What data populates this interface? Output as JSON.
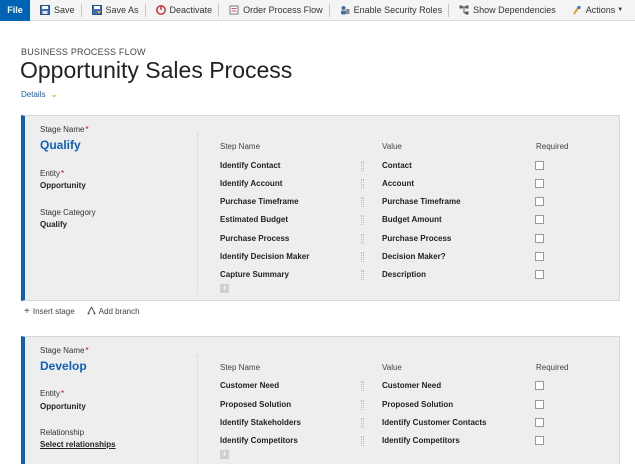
{
  "toolbar": {
    "file": "File",
    "save": "Save",
    "save_as": "Save As",
    "deactivate": "Deactivate",
    "order_process_flow": "Order Process Flow",
    "enable_security_roles": "Enable Security Roles",
    "show_dependencies": "Show Dependencies",
    "actions": "Actions"
  },
  "header": {
    "label": "BUSINESS PROCESS FLOW",
    "title": "Opportunity Sales Process",
    "details": "Details"
  },
  "columns": {
    "step_name": "Step Name",
    "value": "Value",
    "required": "Required"
  },
  "stage_labels": {
    "stage_name": "Stage Name",
    "entity": "Entity",
    "stage_category": "Stage Category",
    "relationship": "Relationship",
    "required_marker": "*"
  },
  "stages": [
    {
      "name": "Qualify",
      "entity": "Opportunity",
      "category": "Qualify",
      "steps": [
        {
          "step": "Identify Contact",
          "value": "Contact"
        },
        {
          "step": "Identify Account",
          "value": "Account"
        },
        {
          "step": "Purchase Timeframe",
          "value": "Purchase Timeframe"
        },
        {
          "step": "Estimated Budget",
          "value": "Budget Amount"
        },
        {
          "step": "Purchase Process",
          "value": "Purchase Process"
        },
        {
          "step": "Identify Decision Maker",
          "value": "Decision Maker?"
        },
        {
          "step": "Capture Summary",
          "value": "Description"
        }
      ]
    },
    {
      "name": "Develop",
      "entity": "Opportunity",
      "relationship": "Select relationships",
      "steps": [
        {
          "step": "Customer Need",
          "value": "Customer Need"
        },
        {
          "step": "Proposed Solution",
          "value": "Proposed Solution"
        },
        {
          "step": "Identify Stakeholders",
          "value": "Identify Customer Contacts"
        },
        {
          "step": "Identify Competitors",
          "value": "Identify Competitors"
        }
      ]
    }
  ],
  "actions": {
    "insert_stage": "Insert stage",
    "add_branch": "Add branch"
  },
  "colors": {
    "accent": "#1160b7",
    "file_bg": "#0063b1",
    "panel_bg": "#eeeeee"
  }
}
